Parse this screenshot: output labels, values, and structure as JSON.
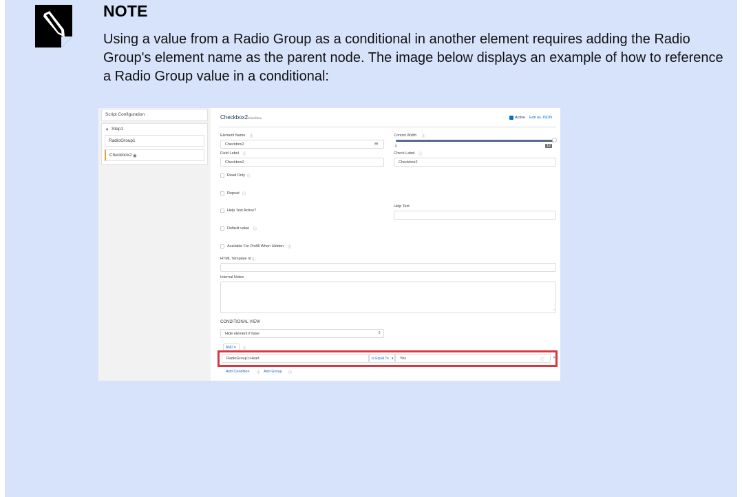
{
  "note": {
    "title": "NOTE",
    "body": "Using a value from a Radio Group as a conditional in another element requires adding the Radio Group's element name as the parent node. The image below displays an example of how to reference a Radio Group value in a conditional:",
    "icon": "note-pencil-icon"
  },
  "screenshot": {
    "sidebar": {
      "header": "Script Configuration",
      "step": "Step1",
      "items": [
        "RadioGroup1",
        "Checkbox2"
      ]
    },
    "header": {
      "title": "Checkbox2",
      "type": "Checkbox",
      "active_label": "Active",
      "edit_json": "Edit as JSON"
    },
    "fields": {
      "element_name_label": "Element Name",
      "element_name_value": "Checkbox2",
      "field_label_label": "Field Label",
      "field_label_value": "Checkbox2",
      "control_width_label": "Control Width",
      "control_width_min": "0",
      "control_width_value": "12",
      "check_label_label": "Check Label",
      "check_label_value": "Checkbox2",
      "read_only": "Read Only",
      "repeat": "Repeat",
      "help_text_active": "Help Text Active?",
      "help_text_label": "Help Text",
      "default_value": "Default value",
      "available_prefill": "Available For Prefill When Hidden",
      "html_template_label": "HTML Template Id",
      "internal_notes_label": "Internal Notes"
    },
    "conditional": {
      "heading": "CONDITIONAL VIEW",
      "select_value": "Hide element if false",
      "logic": "AND",
      "left_operand": "RadioGroup1:Heart",
      "operator": "Is Equal To",
      "right_operand": "Yes",
      "add_condition": "Add Condition",
      "add_group": "Add Group"
    },
    "colors": {
      "highlight": "#d9363e",
      "accent": "#0070d2",
      "slider": "#54698d"
    }
  }
}
